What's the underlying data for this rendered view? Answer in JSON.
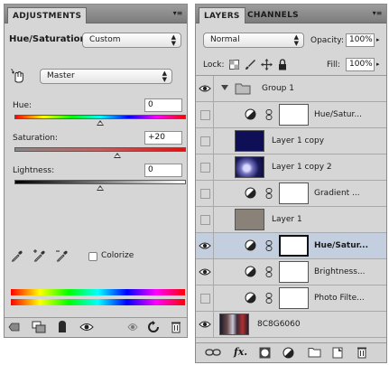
{
  "adjustments": {
    "tab_label": "ADJUSTMENTS",
    "title": "Hue/Saturation",
    "preset": "Custom",
    "channel": "Master",
    "hue": {
      "label": "Hue:",
      "value": "0",
      "level": 0.5
    },
    "saturation": {
      "label": "Saturation:",
      "value": "+20",
      "level": 0.6
    },
    "lightness": {
      "label": "Lightness:",
      "value": "0",
      "level": 0.5
    },
    "colorize_label": "Colorize",
    "colorize_checked": false
  },
  "layers": {
    "tab_label": "LAYERS",
    "channels_tab_label": "CHANNELS",
    "blend_mode": "Normal",
    "opacity_label": "Opacity:",
    "opacity_value": "100%",
    "lock_label": "Lock:",
    "fill_label": "Fill:",
    "fill_value": "100%",
    "rows": [
      {
        "name": "Group 1",
        "type": "group",
        "visible": true
      },
      {
        "name": "Hue/Satur...",
        "type": "adjustment",
        "visible": false
      },
      {
        "name": "Layer 1 copy",
        "type": "pixel-dark",
        "visible": false
      },
      {
        "name": "Layer 1 copy 2",
        "type": "pixel-photo",
        "visible": false
      },
      {
        "name": "Gradient ...",
        "type": "adjustment",
        "visible": false
      },
      {
        "name": "Layer 1",
        "type": "pixel-gray",
        "visible": false
      },
      {
        "name": "Hue/Satur...",
        "type": "adjustment",
        "visible": true,
        "selected": true
      },
      {
        "name": "Brightness...",
        "type": "adjustment",
        "visible": true
      },
      {
        "name": "Photo Filte...",
        "type": "adjustment",
        "visible": false
      },
      {
        "name": "8C8G6060",
        "type": "photo",
        "visible": true
      }
    ]
  },
  "colors": {
    "panel_bg": "#d6d6d6",
    "selected_row": "#c3cfde",
    "layer1_copy_thumb": "#0f0f58",
    "layer1_thumb": "#8a8178"
  }
}
